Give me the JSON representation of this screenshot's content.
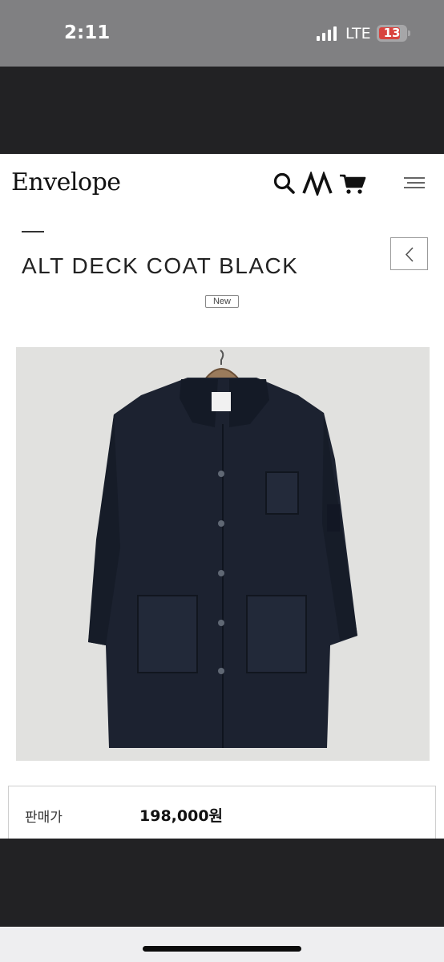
{
  "status_bar": {
    "time": "2:11",
    "network": "LTE",
    "battery_level": "13",
    "battery_color": "#d8443f"
  },
  "header": {
    "logo": "Envelope",
    "icons": [
      "search-icon",
      "brand-logo-icon",
      "cart-icon",
      "menu-icon"
    ]
  },
  "product": {
    "title": "ALT DECK COAT BLACK",
    "badge": "New",
    "back_icon": "chevron-left-icon",
    "price_label": "판매가",
    "price": "198,000원"
  }
}
